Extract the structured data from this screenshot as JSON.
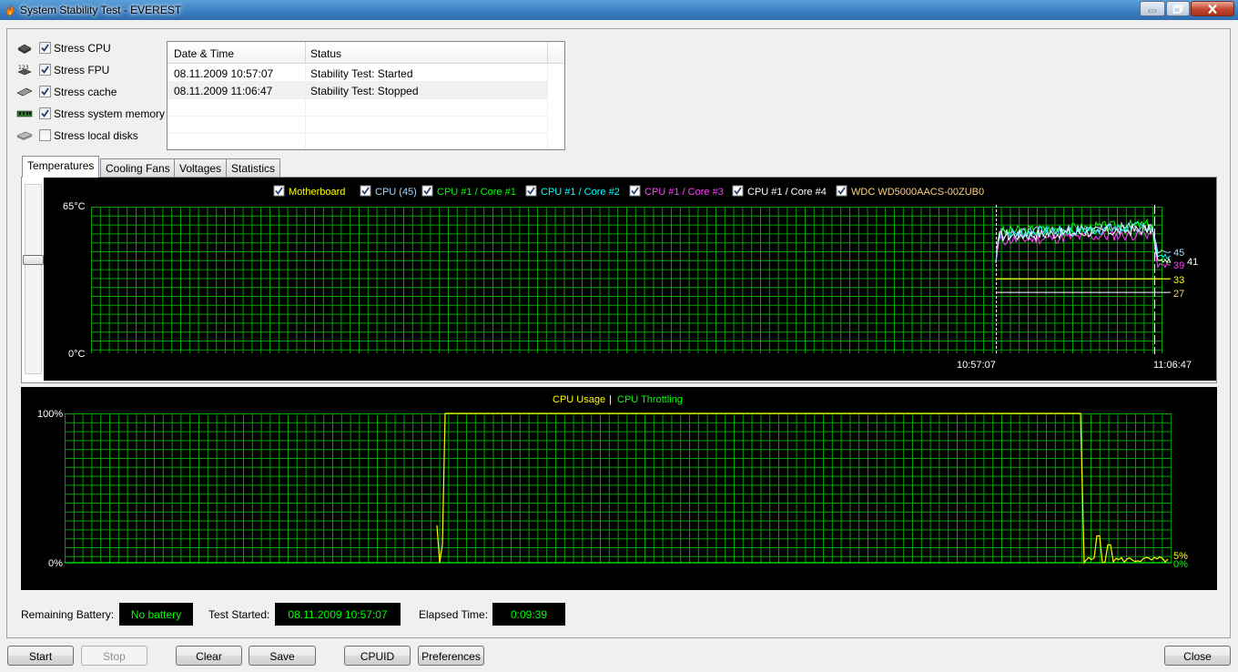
{
  "window": {
    "title": "System Stability Test - EVEREST"
  },
  "stress_options": [
    {
      "label": "Stress CPU",
      "checked": true,
      "icon": "cpu-chip-icon"
    },
    {
      "label": "Stress FPU",
      "checked": true,
      "icon": "fpu-chip-icon"
    },
    {
      "label": "Stress cache",
      "checked": true,
      "icon": "cache-chip-icon"
    },
    {
      "label": "Stress system memory",
      "checked": true,
      "icon": "memory-module-icon"
    },
    {
      "label": "Stress local disks",
      "checked": false,
      "icon": "hard-disk-icon"
    }
  ],
  "log": {
    "columns": [
      "Date & Time",
      "Status"
    ],
    "rows": [
      {
        "time": "08.11.2009 10:57:07",
        "status": "Stability Test: Started"
      },
      {
        "time": "08.11.2009 11:06:47",
        "status": "Stability Test: Stopped"
      }
    ]
  },
  "tabs": [
    "Temperatures",
    "Cooling Fans",
    "Voltages",
    "Statistics"
  ],
  "active_tab": "Temperatures",
  "temperature_graph": {
    "legend": [
      {
        "label": "Motherboard",
        "color": "#ffff00"
      },
      {
        "label": "CPU (45)",
        "color": "#a8d8ff"
      },
      {
        "label": "CPU #1 / Core #1",
        "color": "#00ff00"
      },
      {
        "label": "CPU #1 / Core #2",
        "color": "#00ffff"
      },
      {
        "label": "CPU #1 / Core #3",
        "color": "#ff40ff"
      },
      {
        "label": "CPU #1 / Core #4",
        "color": "#ffffff"
      },
      {
        "label": "WDC WD5000AACS-00ZUB0",
        "color": "#ffd27f"
      }
    ],
    "y_max_label": "65°C",
    "y_min_label": "0°C",
    "x_labels": [
      "10:57:07",
      "11:06:47"
    ],
    "end_values": [
      {
        "value": "45",
        "color": "#a8d8ff"
      },
      {
        "value": "41",
        "color": "#ffffff"
      },
      {
        "value": "39",
        "color": "#ff40ff"
      },
      {
        "value": "33",
        "color": "#ffff00"
      },
      {
        "value": "27",
        "color": "#ffd27f"
      }
    ]
  },
  "cpu_graph": {
    "legend_usage": "CPU Usage",
    "legend_sep": "|",
    "legend_throttling": "CPU Throttling",
    "usage_color": "#ffff00",
    "throttling_color": "#00ff00",
    "y_max_label": "100%",
    "y_min_label": "0%",
    "end_usage": "5%",
    "end_throttling": "0%"
  },
  "status": {
    "battery_label": "Remaining Battery:",
    "battery_value": "No battery",
    "started_label": "Test Started:",
    "started_value": "08.11.2009 10:57:07",
    "elapsed_label": "Elapsed Time:",
    "elapsed_value": "0:09:39"
  },
  "buttons": {
    "start": "Start",
    "stop": "Stop",
    "clear": "Clear",
    "save": "Save",
    "cpuid": "CPUID",
    "preferences": "Preferences",
    "close": "Close"
  },
  "colors": {
    "grid": "#00a000",
    "graph_bg": "#000000",
    "status_text": "#00ff00"
  }
}
